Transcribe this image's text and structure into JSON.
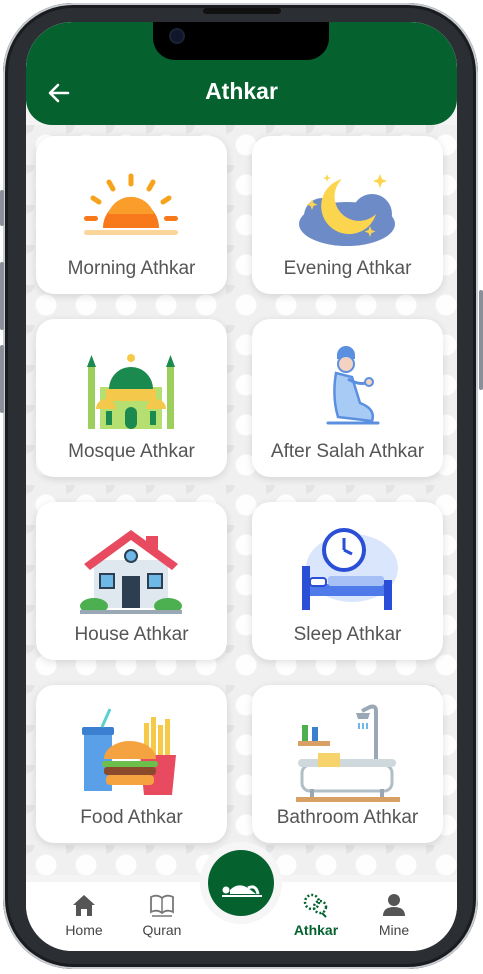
{
  "header": {
    "title": "Athkar"
  },
  "cards": [
    {
      "label": "Morning Athkar"
    },
    {
      "label": "Evening Athkar"
    },
    {
      "label": "Mosque Athkar"
    },
    {
      "label": "After Salah Athkar"
    },
    {
      "label": "House Athkar"
    },
    {
      "label": "Sleep Athkar"
    },
    {
      "label": "Food Athkar"
    },
    {
      "label": "Bathroom Athkar"
    }
  ],
  "nav": {
    "home": "Home",
    "quran": "Quran",
    "athkar": "Athkar",
    "mine": "Mine",
    "active": "athkar"
  },
  "colors": {
    "brand": "#05622f",
    "label": "#555555"
  }
}
